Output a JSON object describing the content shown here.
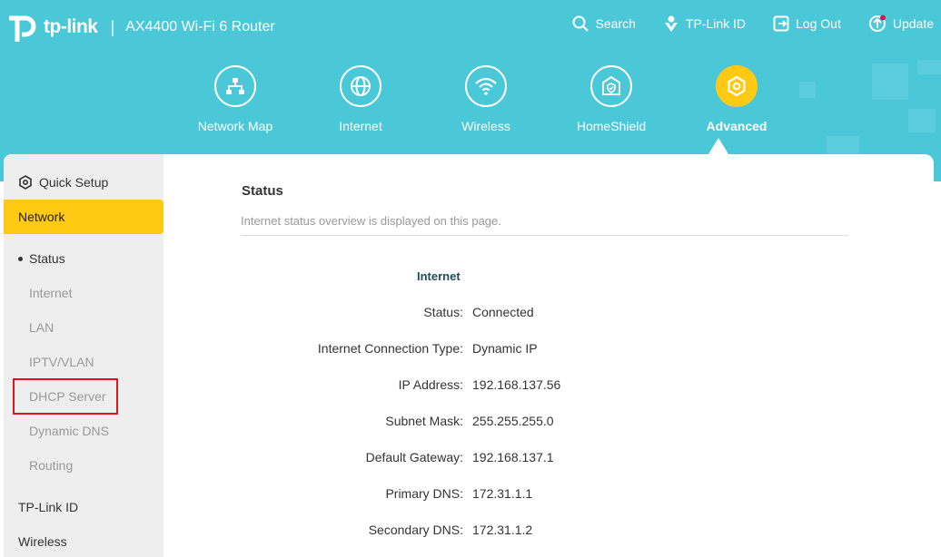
{
  "header": {
    "brand": "tp-link",
    "separator": "|",
    "model": "AX4400 Wi-Fi 6 Router",
    "actions": [
      {
        "label": "Search",
        "icon": "search-icon"
      },
      {
        "label": "TP-Link ID",
        "icon": "tplink-id-icon"
      },
      {
        "label": "Log Out",
        "icon": "logout-icon"
      },
      {
        "label": "Update",
        "icon": "update-icon"
      }
    ],
    "colors": {
      "accent": "#4ac8d8",
      "active": "#ffc914",
      "highlight": "#e0141e"
    }
  },
  "nav": {
    "items": [
      {
        "label": "Network Map",
        "icon": "network-map-icon"
      },
      {
        "label": "Internet",
        "icon": "globe-icon"
      },
      {
        "label": "Wireless",
        "icon": "wifi-icon"
      },
      {
        "label": "HomeShield",
        "icon": "homeshield-icon"
      },
      {
        "label": "Advanced",
        "icon": "advanced-gear-icon",
        "active": true
      }
    ]
  },
  "sidebar": {
    "quick_setup": "Quick Setup",
    "network": "Network",
    "sub_items": [
      "Status",
      "Internet",
      "LAN",
      "IPTV/VLAN",
      "DHCP Server",
      "Dynamic DNS",
      "Routing"
    ],
    "active_sub": "Status",
    "tplink_id": "TP-Link ID",
    "wireless": "Wireless"
  },
  "main": {
    "title": "Status",
    "description": "Internet status overview is displayed on this page.",
    "section": "Internet",
    "rows": [
      {
        "label": "Status:",
        "value": "Connected"
      },
      {
        "label": "Internet Connection Type:",
        "value": "Dynamic IP"
      },
      {
        "label": "IP Address:",
        "value": "192.168.137.56"
      },
      {
        "label": "Subnet Mask:",
        "value": "255.255.255.0"
      },
      {
        "label": "Default Gateway:",
        "value": "192.168.137.1"
      },
      {
        "label": "Primary DNS:",
        "value": "172.31.1.1"
      },
      {
        "label": "Secondary DNS:",
        "value": "172.31.1.2"
      }
    ]
  }
}
